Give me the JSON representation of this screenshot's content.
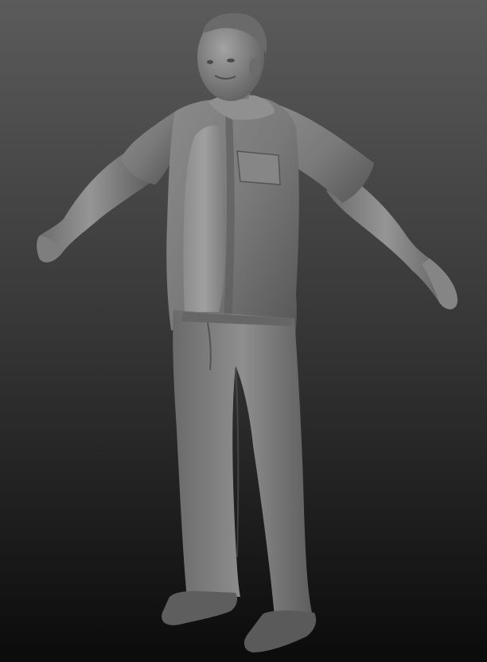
{
  "scene": {
    "subject": "",
    "colors": {
      "background_top": "#5a5a5a",
      "background_bottom": "#0c0c0c",
      "clay_light": "#9a9a9a",
      "clay_mid": "#7d7d7d",
      "clay_dark": "#4a4a4a",
      "clay_shadow": "#2f2f2f"
    }
  }
}
